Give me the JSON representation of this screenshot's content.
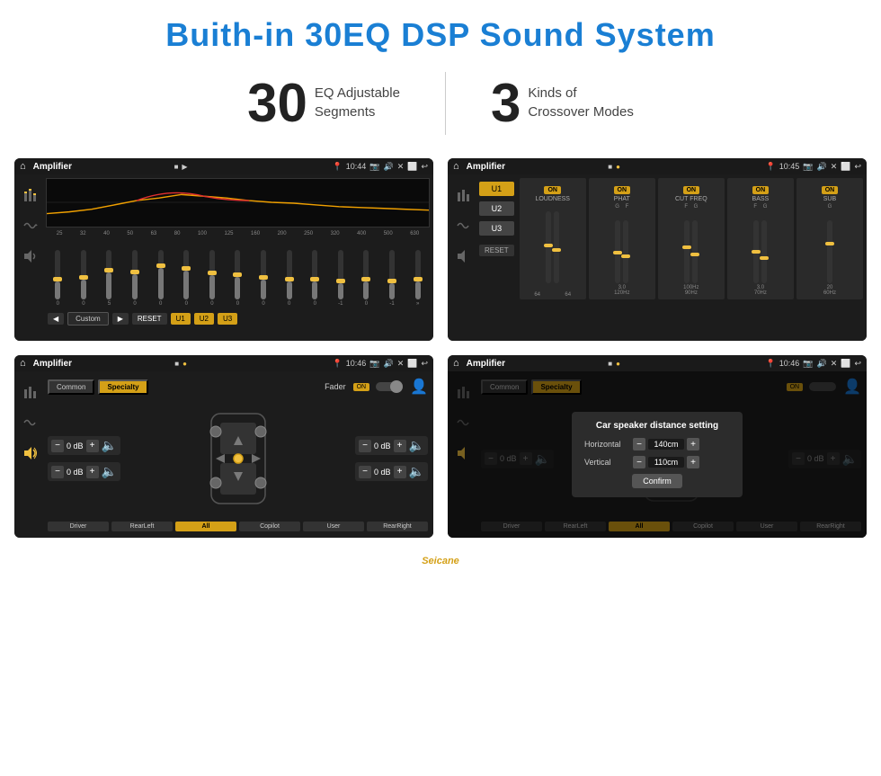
{
  "title": "Buith-in 30EQ DSP Sound System",
  "stats": {
    "eq_number": "30",
    "eq_desc_line1": "EQ Adjustable",
    "eq_desc_line2": "Segments",
    "cross_number": "3",
    "cross_desc_line1": "Kinds of",
    "cross_desc_line2": "Crossover Modes"
  },
  "screens": {
    "screen1": {
      "title": "Amplifier",
      "time": "10:44",
      "eq_labels": [
        "25",
        "32",
        "40",
        "50",
        "63",
        "80",
        "100",
        "125",
        "160",
        "200",
        "250",
        "320",
        "400",
        "500",
        "630"
      ],
      "bottom_controls": {
        "back_btn": "◀",
        "custom_label": "Custom",
        "fwd_btn": "▶",
        "reset_btn": "RESET",
        "u1_btn": "U1",
        "u2_btn": "U2",
        "u3_btn": "U3"
      }
    },
    "screen2": {
      "title": "Amplifier",
      "time": "10:45",
      "sections": [
        "LOUDNESS",
        "PHAT",
        "CUT FREQ",
        "BASS",
        "SUB"
      ],
      "on_labels": [
        "ON",
        "ON",
        "ON",
        "ON",
        "ON"
      ],
      "u_buttons": [
        "U1",
        "U2",
        "U3"
      ],
      "reset_btn": "RESET"
    },
    "screen3": {
      "title": "Amplifier",
      "time": "10:46",
      "common_btn": "Common",
      "specialty_btn": "Specialty",
      "fader_label": "Fader",
      "fader_on": "ON",
      "speaker_positions": {
        "fl": "0 dB",
        "fr": "0 dB",
        "rl": "0 dB",
        "rr": "0 dB"
      },
      "bottom_buttons": [
        "Driver",
        "RearLeft",
        "All",
        "Copilot",
        "User",
        "RearRight"
      ]
    },
    "screen4": {
      "title": "Amplifier",
      "time": "10:46",
      "common_btn": "Common",
      "specialty_btn": "Specialty",
      "modal": {
        "title": "Car speaker distance setting",
        "horizontal_label": "Horizontal",
        "horizontal_value": "140cm",
        "vertical_label": "Vertical",
        "vertical_value": "110cm",
        "confirm_btn": "Confirm"
      },
      "speaker_positions": {
        "fl": "0 dB",
        "fr": "0 dB"
      },
      "bottom_buttons": [
        "Driver",
        "RearLeft",
        "Copilot",
        "RearRight"
      ]
    }
  },
  "watermark": "Seicane",
  "icons": {
    "home": "⌂",
    "pin": "📍",
    "camera": "📷",
    "volume": "🔊",
    "close": "✕",
    "back": "↩",
    "menu": "☰",
    "eq_icon": "≋",
    "wave_icon": "〜",
    "speaker_icon": "◈"
  }
}
